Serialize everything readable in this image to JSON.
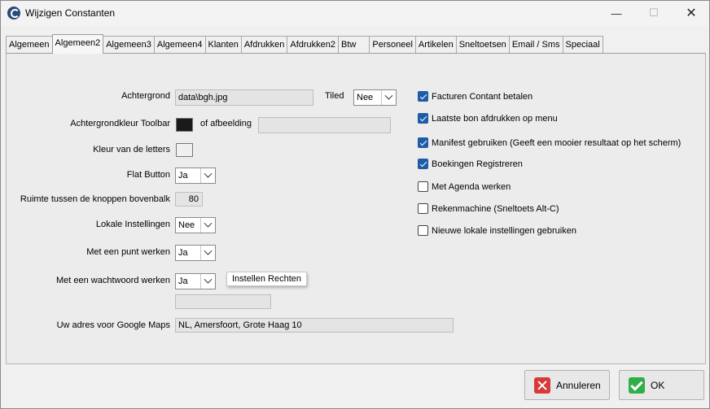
{
  "window": {
    "title": "Wijzigen Constanten"
  },
  "tabs": [
    "Algemeen",
    "Algemeen2",
    "Algemeen3",
    "Algemeen4",
    "Klanten",
    "Afdrukken",
    "Afdrukken2",
    "Btw",
    "Personeel",
    "Artikelen",
    "Sneltoetsen",
    "Email / Sms",
    "Speciaal"
  ],
  "active_tab": "Algemeen2",
  "form": {
    "achtergrond_label": "Achtergrond",
    "achtergrond_value": "data\\bgh.jpg",
    "tiled_label": "Tiled",
    "tiled_value": "Nee",
    "toolbar_color_label": "Achtergrondkleur Toolbar",
    "toolbar_color": "#1a1a1a",
    "of_afbeelding_label": "of afbeelding",
    "of_afbeelding_value": "",
    "letter_color_label": "Kleur van de letters",
    "letter_color": "#f0f0f0",
    "flat_button_label": "Flat Button",
    "flat_button_value": "Ja",
    "spacing_label": "Ruimte tussen de knoppen bovenbalk",
    "spacing_value": "80",
    "local_settings_label": "Lokale Instellingen",
    "local_settings_value": "Nee",
    "dot_label": "Met een punt werken",
    "dot_value": "Ja",
    "password_label": "Met een wachtwoord werken",
    "password_value": "Ja",
    "rights_button": "Instellen Rechten",
    "password_field_value": "",
    "maps_label": "Uw adres voor Google Maps",
    "maps_value": "NL, Amersfoort, Grote Haag 10"
  },
  "checkboxes": [
    {
      "label": "Facturen Contant betalen",
      "checked": true
    },
    {
      "label": "Laatste bon afdrukken op menu",
      "checked": true
    },
    {
      "label": "Manifest gebruiken (Geeft een mooier resultaat op het scherm)",
      "checked": true
    },
    {
      "label": "Boekingen Registreren",
      "checked": true
    },
    {
      "label": "Met Agenda werken",
      "checked": false
    },
    {
      "label": "Rekenmachine (Sneltoets Alt-C)",
      "checked": false
    },
    {
      "label": "Nieuwe lokale instellingen gebruiken",
      "checked": false
    }
  ],
  "buttons": {
    "cancel": "Annuleren",
    "ok": "OK"
  },
  "colors": {
    "accent": "#1f5ca8",
    "cancel": "#d63a3a",
    "ok": "#2fae4a"
  }
}
